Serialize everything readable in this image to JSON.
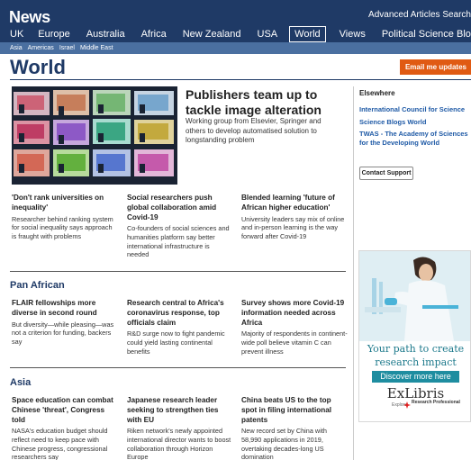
{
  "header": {
    "brand": "News",
    "adv_search": "Advanced Articles Search",
    "nav": [
      "UK",
      "Europe",
      "Australia",
      "Africa",
      "New Zealand",
      "USA",
      "World",
      "Views",
      "Political Science Blog"
    ],
    "subnav": [
      "Asia",
      "Americas",
      "Israel",
      "Middle East"
    ]
  },
  "page": {
    "title": "World",
    "email_button": "Email me updates"
  },
  "hero": {
    "title": "Publishers team up to tackle image alteration",
    "desc": "Working group from Elsevier, Springer and others to develop automatised solution to longstanding problem"
  },
  "stories_top": [
    {
      "title": "'Don't rank universities on inequality'",
      "desc": "Researcher behind ranking system for social inequality says approach is fraught with problems"
    },
    {
      "title": "Social researchers push global collaboration amid Covid-19",
      "desc": "Co-founders of social sciences and humanities platform say better international infrastructure is needed"
    },
    {
      "title": "Blended learning 'future of African higher education'",
      "desc": "University leaders say mix of online and in-person learning is the way forward after Covid-19"
    }
  ],
  "sections": [
    {
      "title": "Pan African",
      "stories": [
        {
          "title": "FLAIR fellowships more diverse in second round",
          "desc": "But diversity—while pleasing—was not a criterion for funding, backers say"
        },
        {
          "title": "Research central to Africa's coronavirus response, top officials claim",
          "desc": "R&D surge now to fight pandemic could yield lasting continental benefits"
        },
        {
          "title": "Survey shows more Covid-19 information needed across Africa",
          "desc": "Majority of respondents in continent-wide poll believe vitamin C can prevent illness"
        }
      ]
    },
    {
      "title": "Asia",
      "stories": [
        {
          "title": "Space education can combat Chinese 'threat', Congress told",
          "desc": "NASA's education budget should reflect need to keep pace with Chinese progress, congressional researchers say"
        },
        {
          "title": "Japanese research leader seeking to strengthen ties with EU",
          "desc": "Riken network's newly appointed international director wants to boost collaboration through Horizon Europe"
        },
        {
          "title": "China beats US to the top spot in filing international patents",
          "desc": "New record set by China with 58,990 applications in 2019, overtaking decades-long US domination"
        }
      ]
    }
  ],
  "sidebar": {
    "heading": "Elsewhere",
    "links": [
      "International Council for Science",
      "Science Blogs World",
      "TWAS - The Academy of Sciences",
      "for the Developing World"
    ],
    "contact_button": "Contact Support"
  },
  "ad": {
    "line1": "Your path to create",
    "line2": "research impact",
    "cta": "Discover more here",
    "logo": "ExLibris",
    "logo_sub": "Explore",
    "logo_sub2": "Research Professional"
  },
  "colors": {
    "brand_navy": "#1f3a66",
    "subnav_blue": "#4a6fa0",
    "email_orange": "#e05a13",
    "link_blue": "#1f5aa6",
    "ad_teal": "#1e8da0"
  }
}
